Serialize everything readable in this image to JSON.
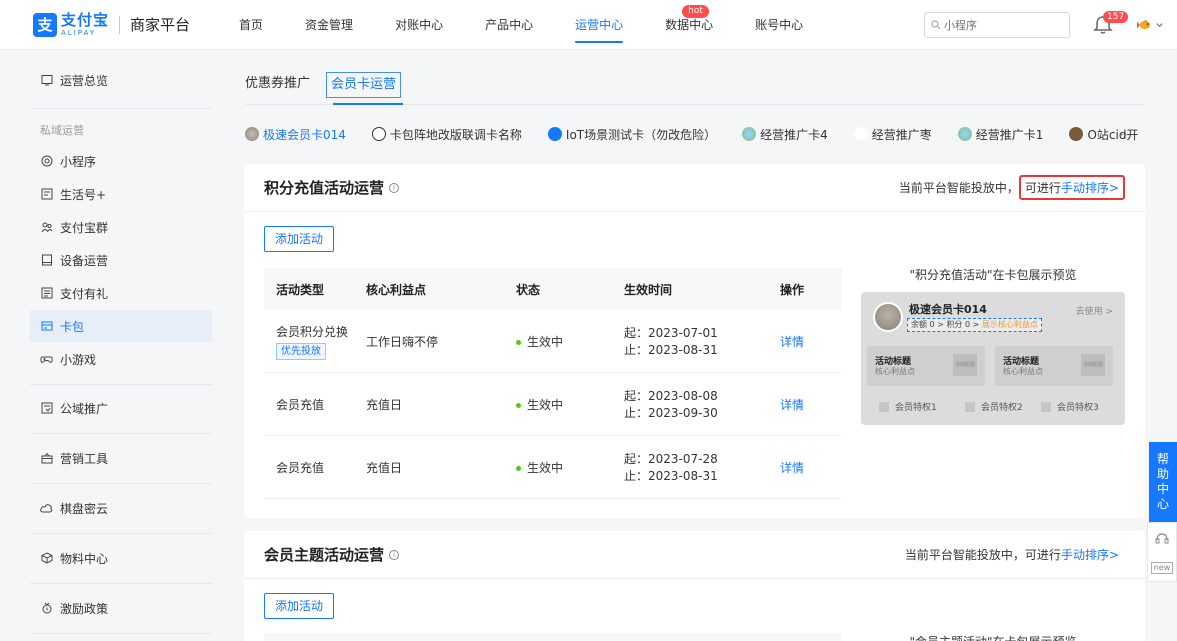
{
  "header": {
    "logo_cn": "支付宝",
    "logo_en": "ALIPAY",
    "platform": "商家平台",
    "nav": [
      {
        "label": "首页"
      },
      {
        "label": "资金管理"
      },
      {
        "label": "对账中心"
      },
      {
        "label": "产品中心"
      },
      {
        "label": "运营中心"
      },
      {
        "label": "数据中心"
      },
      {
        "label": "账号中心"
      }
    ],
    "hot_badge": "hot",
    "search_placeholder": "小程序",
    "notification_count": "157"
  },
  "sidebar": {
    "items": [
      {
        "label": "运营总览",
        "icon": "monitor-icon"
      },
      {
        "label": "小程序",
        "icon": "mini-program-icon"
      },
      {
        "label": "生活号+",
        "icon": "life-account-icon"
      },
      {
        "label": "支付宝群",
        "icon": "group-icon"
      },
      {
        "label": "设备运营",
        "icon": "device-icon"
      },
      {
        "label": "支付有礼",
        "icon": "gift-icon"
      },
      {
        "label": "卡包",
        "icon": "card-wallet-icon"
      },
      {
        "label": "小游戏",
        "icon": "gamepad-icon"
      },
      {
        "label": "公域推广",
        "icon": "promotion-icon"
      },
      {
        "label": "营销工具",
        "icon": "marketing-icon"
      },
      {
        "label": "棋盘密云",
        "icon": "cloud-icon"
      },
      {
        "label": "物料中心",
        "icon": "material-icon"
      },
      {
        "label": "激励政策",
        "icon": "incentive-icon"
      }
    ],
    "group_label": "私域运营",
    "active_index": 6
  },
  "main": {
    "tabs": [
      {
        "label": "优惠券推广"
      },
      {
        "label": "会员卡运营"
      }
    ],
    "card_chips": [
      {
        "label": "极速会员卡014"
      },
      {
        "label": "卡包阵地改版联调卡名称"
      },
      {
        "label": "IoT场景测试卡（勿改危险）"
      },
      {
        "label": "经营推广卡4"
      },
      {
        "label": "经营推广枣"
      },
      {
        "label": "经营推广卡1"
      },
      {
        "label": "O站cid开"
      }
    ],
    "more": "···",
    "points_panel": {
      "title": "积分充值活动运营",
      "notice_prefix": "当前平台智能投放中，",
      "notice_mid": "可进行",
      "notice_link": "手动排序>",
      "add_button": "添加活动",
      "columns": [
        "活动类型",
        "核心利益点",
        "状态",
        "生效时间",
        "操作"
      ],
      "rows": [
        {
          "type": "会员积分兑换",
          "tag": "优先投放",
          "benefit": "工作日嗨不停",
          "status": "生效中",
          "start": "起：2023-07-01",
          "end": "止：2023-08-31",
          "action": "详情"
        },
        {
          "type": "会员充值",
          "tag": "",
          "benefit": "充值日",
          "status": "生效中",
          "start": "起：2023-08-08",
          "end": "止：2023-09-30",
          "action": "详情"
        },
        {
          "type": "会员充值",
          "tag": "",
          "benefit": "充值日",
          "status": "生效中",
          "start": "起：2023-07-28",
          "end": "止：2023-08-31",
          "action": "详情"
        }
      ],
      "preview_title": "\"积分充值活动\"在卡包展示预览",
      "preview": {
        "card_name": "极速会员卡014",
        "use_text": "去使用 >",
        "balance": "余额 0 >",
        "points": "积分 0 >",
        "benefit_tag": "展示核心利益点",
        "box1_title": "活动标题",
        "box1_sub": "核心利益点",
        "box2_title": "活动标题",
        "box2_sub": "核心利益点",
        "box_img": "活动配图",
        "privileges": [
          "会员特权1",
          "会员特权2",
          "会员特权3"
        ]
      }
    },
    "theme_panel": {
      "title": "会员主题活动运营",
      "notice_prefix": "当前平台智能投放中，",
      "notice_mid": "可进行",
      "notice_link": "手动排序>",
      "add_button": "添加活动",
      "preview_title": "\"会员主题活动\"在卡包展示预览"
    }
  },
  "help": {
    "label": [
      "帮",
      "助",
      "中",
      "心"
    ],
    "new_label": "new"
  }
}
